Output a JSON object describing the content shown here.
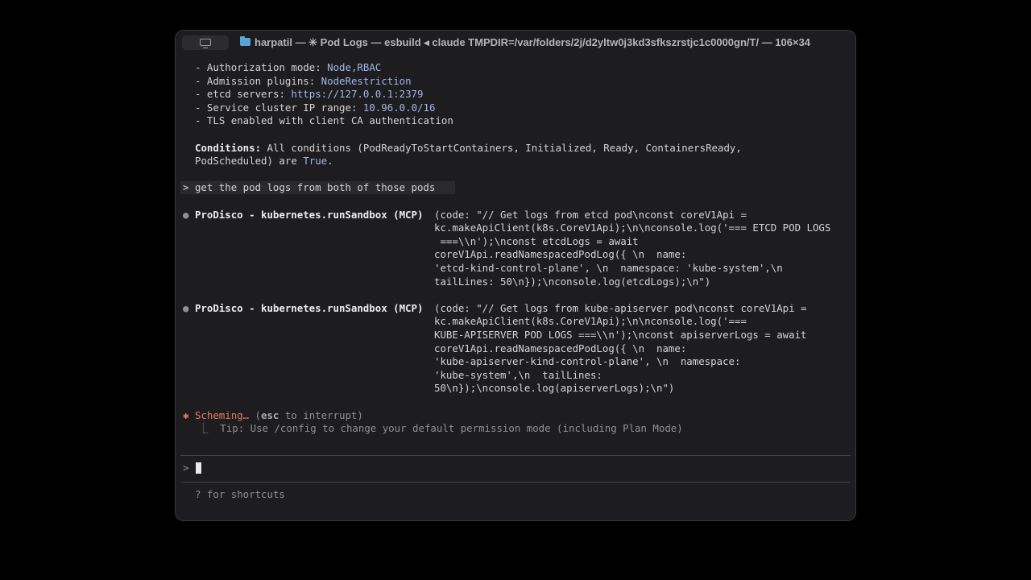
{
  "window": {
    "title": "harpatil — ✳ Pod Logs — esbuild ◂ claude TMPDIR=/var/folders/2j/d2yltw0j3kd3sfkszrstjc1c0000gn/T/ — 106×34"
  },
  "terminal": {
    "config_lines": [
      {
        "dash": "- ",
        "label": "Authorization mode: ",
        "value": "Node,RBAC"
      },
      {
        "dash": "- ",
        "label": "Admission plugins: ",
        "value": "NodeRestriction"
      },
      {
        "dash": "- ",
        "label": "etcd servers: ",
        "value": "https://127.0.0.1:2379"
      },
      {
        "dash": "- ",
        "label": "Service cluster IP range: ",
        "value": "10.96.0.0/16"
      },
      {
        "dash": "- ",
        "label": "TLS enabled with client CA authentication",
        "value": ""
      }
    ],
    "conditions": {
      "label": "Conditions:",
      "text1": " All conditions (PodReadyToStartContainers, Initialized, Ready, ContainersReady,",
      "text2": "PodScheduled) are ",
      "value": "True",
      "end": "."
    },
    "user_prompt": {
      "caret": ">",
      "text": "get the pod logs from both of those pods"
    },
    "tool_calls": [
      {
        "bullet": "●",
        "name": "ProDisco - kubernetes.runSandbox (MCP)",
        "lines": [
          "(code: \"// Get logs from etcd pod\\nconst coreV1Api =",
          "kc.makeApiClient(k8s.CoreV1Api);\\n\\nconsole.log('=== ETCD POD LOGS",
          " ===\\\\n');\\nconst etcdLogs = await",
          "coreV1Api.readNamespacedPodLog({ \\n  name:",
          "'etcd-kind-control-plane', \\n  namespace: 'kube-system',\\n",
          "tailLines: 50\\n});\\nconsole.log(etcdLogs);\\n\")"
        ]
      },
      {
        "bullet": "●",
        "name": "ProDisco - kubernetes.runSandbox (MCP)",
        "lines": [
          "(code: \"// Get logs from kube-apiserver pod\\nconst coreV1Api =",
          "kc.makeApiClient(k8s.CoreV1Api);\\n\\nconsole.log('===",
          "KUBE-APISERVER POD LOGS ===\\\\n');\\nconst apiserverLogs = await",
          "coreV1Api.readNamespacedPodLog({ \\n  name:",
          "'kube-apiserver-kind-control-plane', \\n  namespace:",
          "'kube-system',\\n  tailLines:",
          "50\\n});\\nconsole.log(apiserverLogs);\\n\")"
        ]
      }
    ],
    "status": {
      "spinner": "✱",
      "label": "Scheming…",
      "paren_open": " (",
      "key": "esc",
      "paren_rest": " to interrupt)"
    },
    "tip": {
      "glyph": "⎿",
      "text": "  Tip: Use /config to change your default permission mode (including Plan Mode)"
    },
    "input": {
      "caret": ">",
      "value": ""
    },
    "footer": {
      "hint": "? for shortcuts"
    }
  }
}
